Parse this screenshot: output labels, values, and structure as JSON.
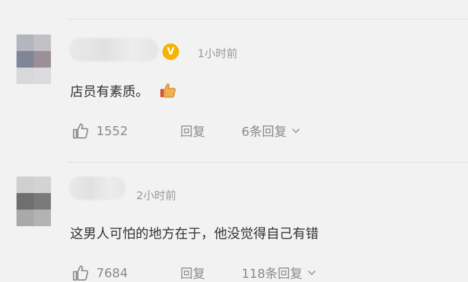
{
  "comments": [
    {
      "time": "1小时前",
      "text": "店员有素质。",
      "badge": "V",
      "likes": "1552",
      "reply_label": "回复",
      "replies_label": "6条回复"
    },
    {
      "time": "2小时前",
      "text": "这男人可怕的地方在于，他没觉得自己有错",
      "likes": "7684",
      "reply_label": "回复",
      "replies_label": "118条回复"
    }
  ],
  "colors": {
    "background": "#f2f2f2",
    "text": "#333333",
    "muted": "#999999",
    "badge": "#f4b400"
  },
  "icons": [
    "thumb-up-icon",
    "chevron-down-icon",
    "verified-badge-icon",
    "thumbs-up-emoji"
  ]
}
